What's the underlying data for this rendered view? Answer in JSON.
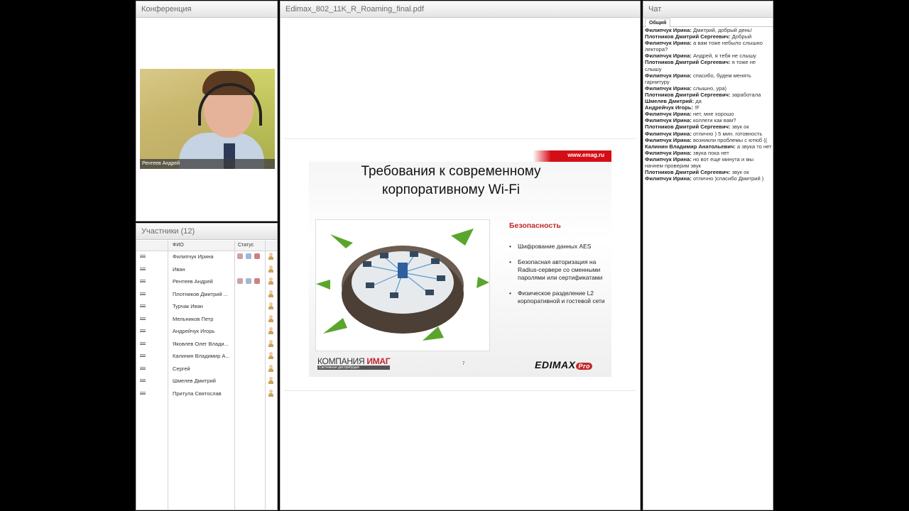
{
  "conference": {
    "title": "Конференция",
    "video_caption": "Рентеев Андрей"
  },
  "participants": {
    "title": "Участники (12)",
    "col_name": "ФИО",
    "col_status": "Статус",
    "rows": [
      {
        "name": "Филипчук Ирина",
        "status": true
      },
      {
        "name": "Иван",
        "status": false
      },
      {
        "name": "Рентеев Андрей",
        "status": true
      },
      {
        "name": "Плотников Дмитрий ...",
        "status": false
      },
      {
        "name": "Турчак Иван",
        "status": false
      },
      {
        "name": "Мельников Петр",
        "status": false
      },
      {
        "name": "Андрейчук Игорь",
        "status": false
      },
      {
        "name": "Яковлев Олег  Влади...",
        "status": false
      },
      {
        "name": "Калинин Владимир  А...",
        "status": false
      },
      {
        "name": "Сергей",
        "status": false
      },
      {
        "name": "Шмелев Дмитрий",
        "status": false
      },
      {
        "name": "Притула Святослав",
        "status": false
      }
    ]
  },
  "document": {
    "title": "Edimax_802_11K_R_Roaming_final.pdf",
    "slide": {
      "url": "www.emag.ru",
      "title_line1": "Требования к современному",
      "title_line2": "корпоративному Wi-Fi",
      "section": "Безопасность",
      "bullets": [
        "Шифрование данных AES",
        "Безопасная авторизация на Radius-сервере со сменными паролями или сертификатами",
        "Физическое разделение L2 корпоративной и гостевой сети"
      ],
      "logo_left_a": "КОМПАНИЯ ",
      "logo_left_b": "ИМАГ",
      "logo_left_sub": "Системная дистрибуция",
      "page_number": "7",
      "logo_right": "EDIMAX",
      "logo_right_pro": "Pro"
    }
  },
  "chat": {
    "title": "Чат",
    "tab": "Общий",
    "messages": [
      {
        "author": "Филипчук Ирина:",
        "text": " Дмитрий, добрый день!"
      },
      {
        "author": "Плотников Дмитрий  Сергеевич:",
        "text": " Добрый"
      },
      {
        "author": "Филипчук Ирина:",
        "text": " а вам тоже небыло слышно лектора?"
      },
      {
        "author": "Филипчук Ирина:",
        "text": " Андрей, я тебя не слышу"
      },
      {
        "author": "Плотников Дмитрий  Сергеевич:",
        "text": " я тоже не слышу"
      },
      {
        "author": "Филипчук Ирина:",
        "text": " спасибо, будем менять гарнитуру"
      },
      {
        "author": "Филипчук Ирина:",
        "text": " слышно, ура)"
      },
      {
        "author": "Плотников Дмитрий  Сергеевич:",
        "text": " заработала"
      },
      {
        "author": "Шмелев Дмитрий:",
        "text": " да"
      },
      {
        "author": "Андрейчук Игорь:",
        "text": " !F"
      },
      {
        "author": "Филипчук Ирина:",
        "text": " нет, мне хорошо"
      },
      {
        "author": "Филипчук Ирина:",
        "text": " коллеги как вам?"
      },
      {
        "author": "Плотников Дмитрий  Сергеевич:",
        "text": " звук ок"
      },
      {
        "author": "Филипчук Ирина:",
        "text": " отлично ) 5 мин. готовность"
      },
      {
        "author": "Филипчук Ирина:",
        "text": " возникли проблемы с ютюб (("
      },
      {
        "author": "Калинин Владимир  Анатольевич:",
        "text": " а звука то нет"
      },
      {
        "author": "Филипчук Ирина:",
        "text": " звука пока нет"
      },
      {
        "author": "Филипчук Ирина:",
        "text": " но вот еще минута и мы начнем проверим звук"
      },
      {
        "author": "Плотников Дмитрий  Сергеевич:",
        "text": " звук ок"
      },
      {
        "author": "Филипчук Ирина:",
        "text": " отлично )спасибо Дмитрий )"
      }
    ]
  }
}
